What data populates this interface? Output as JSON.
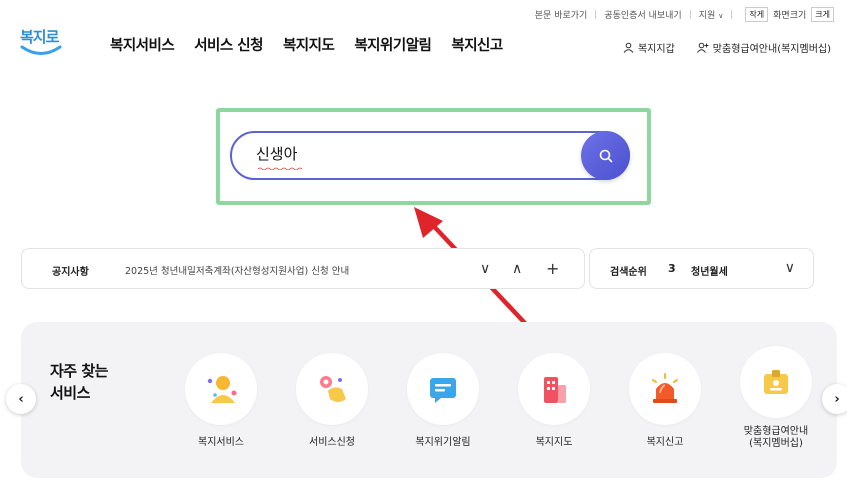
{
  "utility": {
    "skip_link": "본문 바로가기",
    "cert_export": "공동인증서 내보내기",
    "support": "지원",
    "font_small": "작게",
    "font_label": "화면크기",
    "font_large": "크게"
  },
  "logo": {
    "text": "복지로"
  },
  "gnb": {
    "items": [
      "복지서비스",
      "서비스 신청",
      "복지지도",
      "복지위기알림",
      "복지신고"
    ]
  },
  "header_right": {
    "wallet": "복지지갑",
    "guide": "맞춤형급여안내(복지멤버십)"
  },
  "search": {
    "value": "신생아"
  },
  "notice": {
    "label": "공지사항",
    "text": "2025년 청년내일저축계좌(자산형성지원사업) 신청 안내"
  },
  "ranking": {
    "label": "검색순위",
    "rank": "3",
    "term": "청년월세"
  },
  "services": {
    "title_line1": "자주 찾는",
    "title_line2": "서비스",
    "items": [
      {
        "label": "복지서비스"
      },
      {
        "label": "서비스신청"
      },
      {
        "label": "복지위기알림"
      },
      {
        "label": "복지지도"
      },
      {
        "label": "복지신고"
      },
      {
        "label": "맞춤형급여안내",
        "label2": "(복지멤버십)"
      }
    ]
  },
  "colors": {
    "accent": "#5b62d4",
    "highlight": "#8ed79f",
    "arrow": "#e0242b"
  }
}
